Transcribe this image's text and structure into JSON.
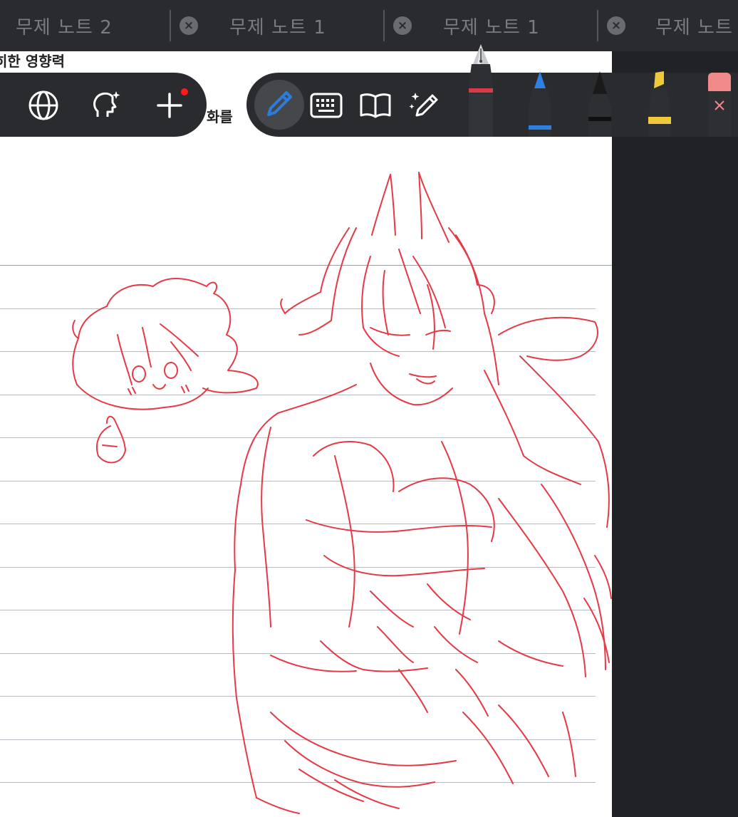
{
  "tabs": [
    {
      "label": "무제 노트 2"
    },
    {
      "label": "무제 노트 1"
    },
    {
      "label": "무제 노트 1"
    },
    {
      "label": "무제 노트"
    }
  ],
  "document": {
    "header_text": "히한 영향력",
    "partial_text": "화를"
  },
  "toolbar": {
    "left": [
      "globe-icon",
      "ai-head-icon",
      "add-icon"
    ],
    "right": [
      "pen-tool-icon",
      "keyboard-icon",
      "book-icon",
      "magic-pen-icon"
    ]
  },
  "pens": [
    {
      "name": "fountain-pen",
      "color": "#d93a45"
    },
    {
      "name": "ballpoint-pen",
      "color": "#2f7fe0"
    },
    {
      "name": "pencil",
      "color": "#1a1a1a"
    },
    {
      "name": "highlighter",
      "color": "#f0c93a"
    },
    {
      "name": "eraser",
      "color": "#f08a8a"
    }
  ],
  "ink_color": "#e63946",
  "accent_color": "#2a7dde"
}
